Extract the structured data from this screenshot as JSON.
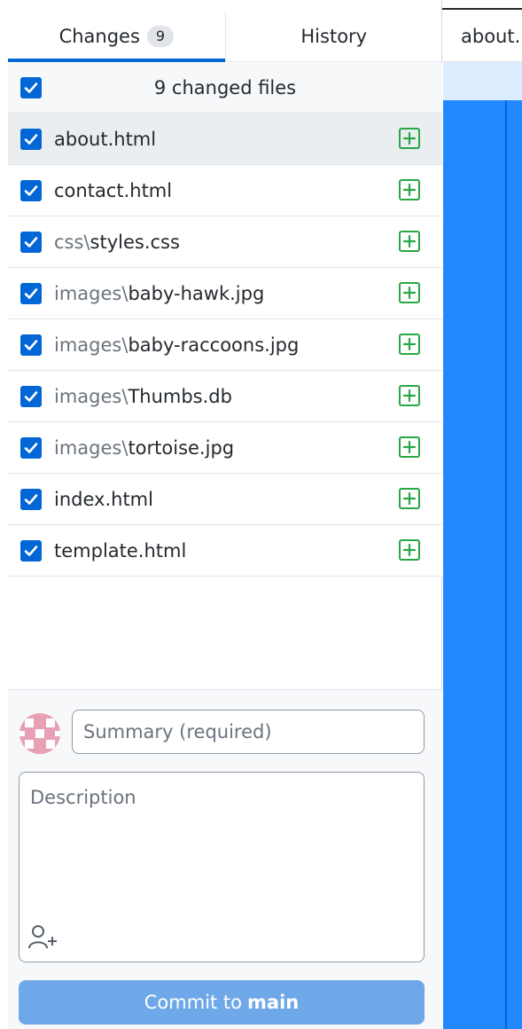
{
  "tabs": [
    {
      "label": "Changes",
      "count": "9",
      "active": true
    },
    {
      "label": "History",
      "active": false
    }
  ],
  "file_header": {
    "label": "9 changed files"
  },
  "files": [
    {
      "dir": "",
      "name": "about.html",
      "selected": true
    },
    {
      "dir": "",
      "name": "contact.html",
      "selected": false
    },
    {
      "dir": "css\\",
      "name": "styles.css",
      "selected": false
    },
    {
      "dir": "images\\",
      "name": "baby-hawk.jpg",
      "selected": false
    },
    {
      "dir": "images\\",
      "name": "baby-raccoons.jpg",
      "selected": false
    },
    {
      "dir": "images\\",
      "name": "Thumbs.db",
      "selected": false
    },
    {
      "dir": "images\\",
      "name": "tortoise.jpg",
      "selected": false
    },
    {
      "dir": "",
      "name": "index.html",
      "selected": false
    },
    {
      "dir": "",
      "name": "template.html",
      "selected": false
    }
  ],
  "commit": {
    "summary_placeholder": "Summary (required)",
    "description_placeholder": "Description",
    "button_prefix": "Commit to",
    "branch": "main"
  },
  "diff": {
    "file_tab_label": "about.html"
  },
  "colors": {
    "accent": "#0366d6",
    "added": "#28a745",
    "commit_button": "#6fa8e8",
    "diff_background": "#2188ff"
  },
  "icons": {
    "checkbox": "checkmark-icon",
    "file_status": "file-added-icon",
    "coauthor": "add-coauthor-icon",
    "avatar": "user-avatar"
  }
}
